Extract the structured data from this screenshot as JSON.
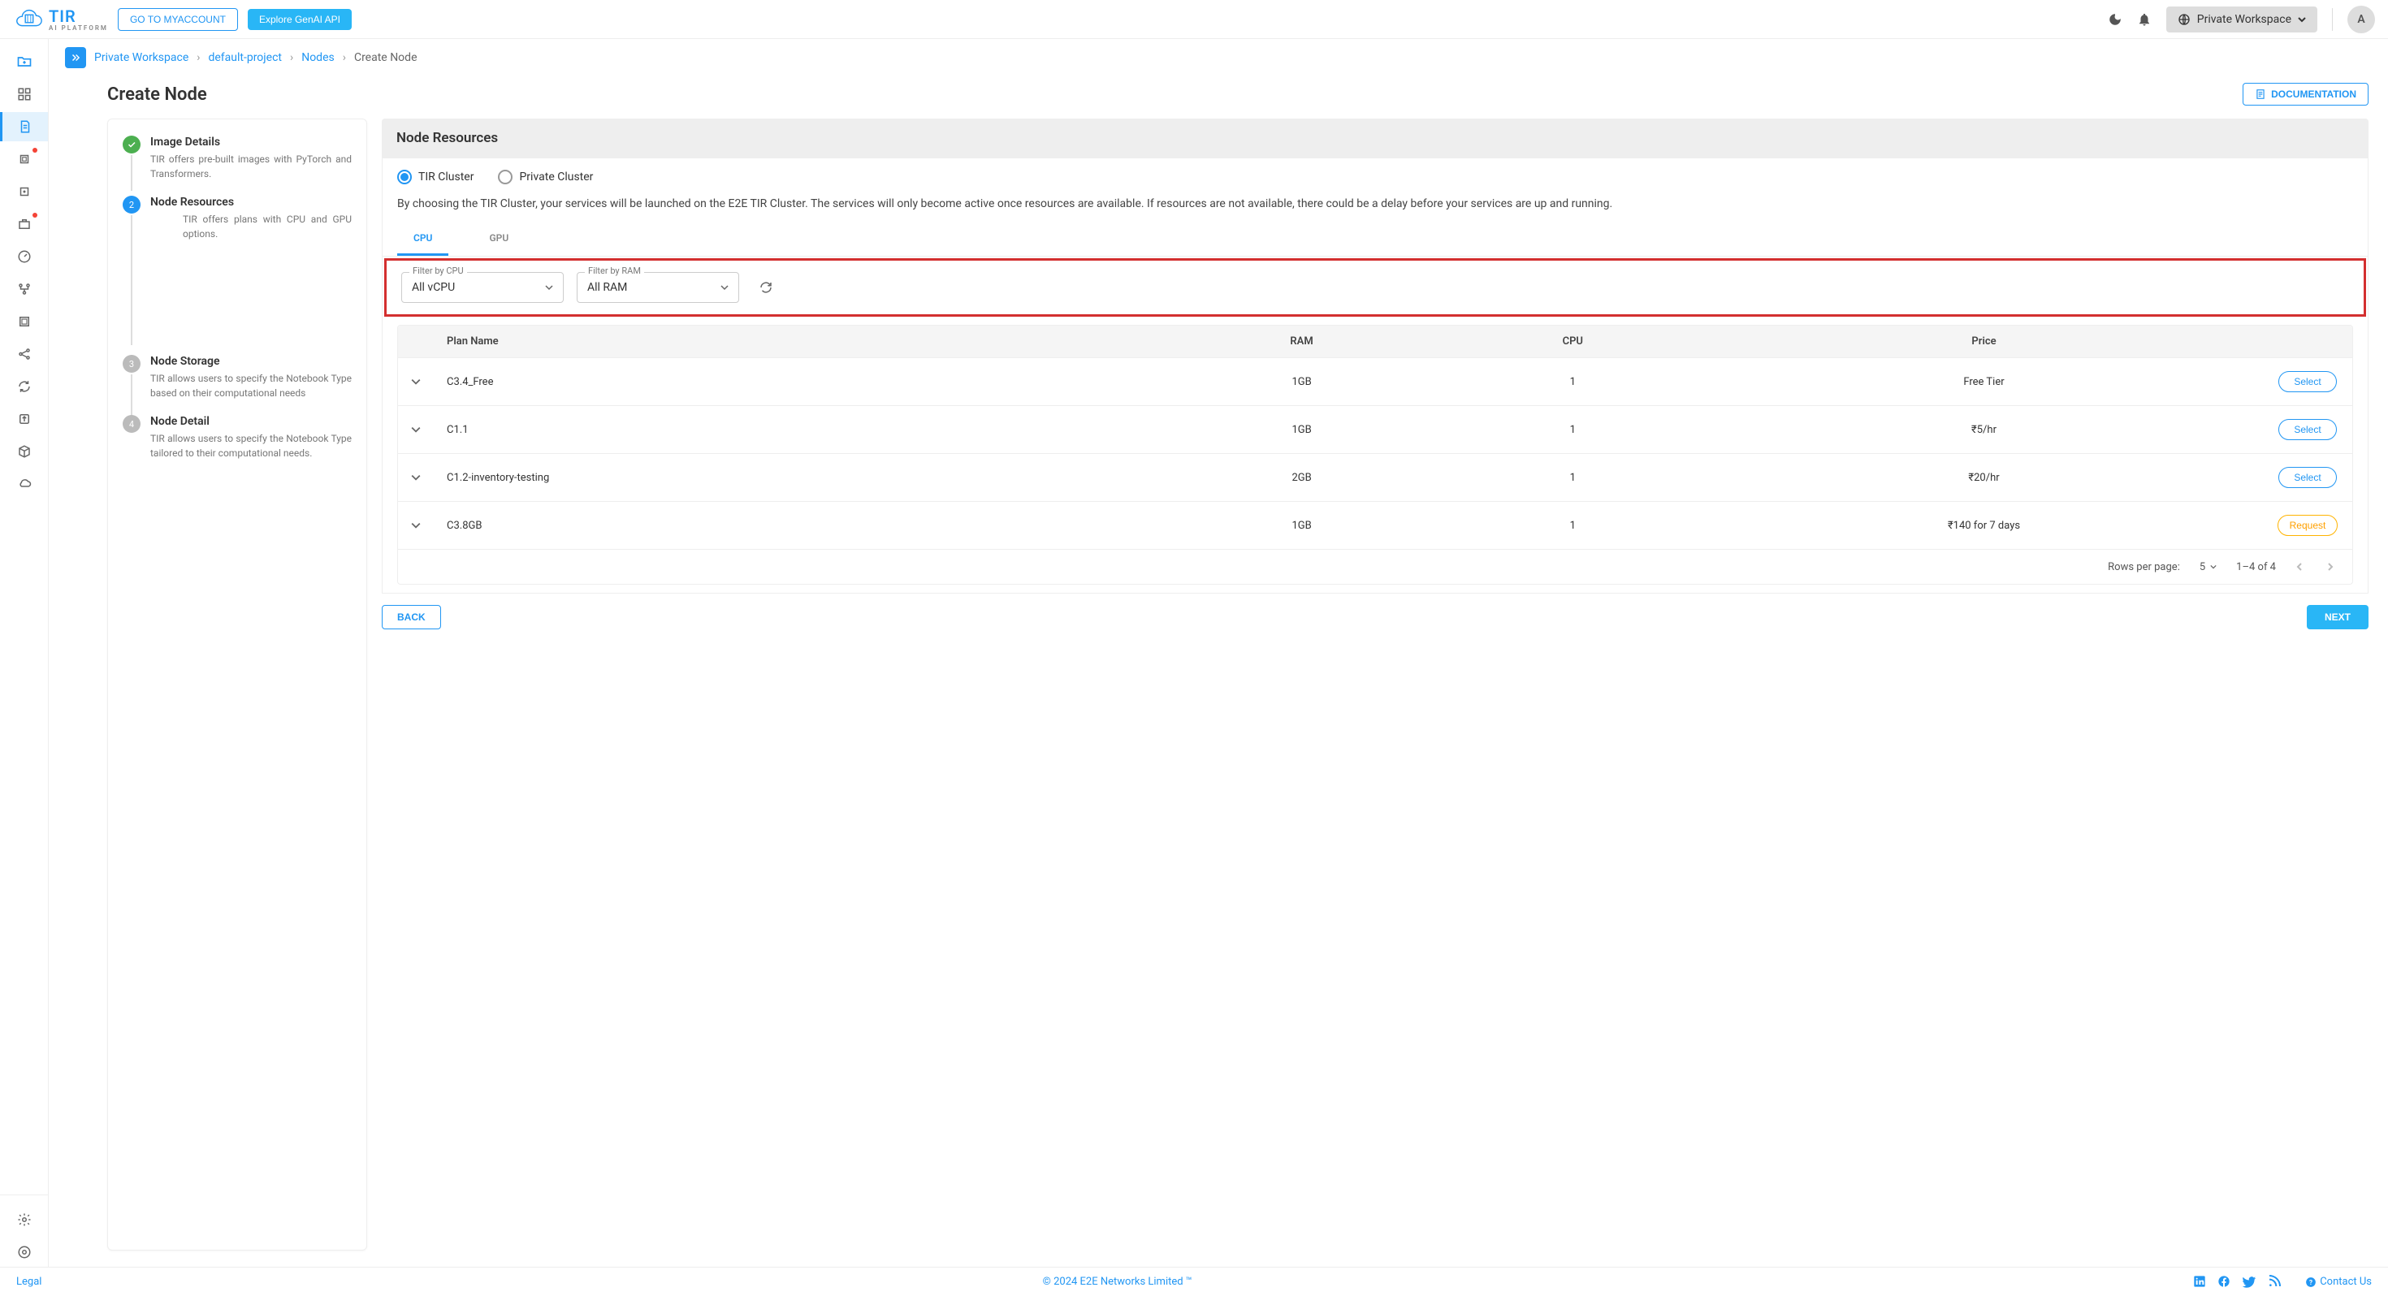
{
  "topbar": {
    "brand": "TIR",
    "brand_sub": "AI PLATFORM",
    "go_account": "GO TO MYACCOUNT",
    "explore": "Explore GenAI API",
    "workspace": "Private Workspace",
    "avatar": "A"
  },
  "breadcrumb": {
    "items": [
      "Private Workspace",
      "default-project",
      "Nodes"
    ],
    "current": "Create Node"
  },
  "page": {
    "title": "Create Node",
    "doc_btn": "DOCUMENTATION"
  },
  "steps": [
    {
      "title": "Image Details",
      "desc": "TIR offers pre-built images with PyTorch and Transformers.",
      "state": "done"
    },
    {
      "title": "Node Resources",
      "desc": "TIR offers plans with CPU and GPU options.",
      "state": "active"
    },
    {
      "title": "Node Storage",
      "desc": "TIR allows users to specify the Notebook Type based on their computational needs",
      "state": "pending",
      "num": "3"
    },
    {
      "title": "Node Detail",
      "desc": "TIR allows users to specify the Notebook Type tailored to their computational needs.",
      "state": "pending",
      "num": "4"
    }
  ],
  "resources": {
    "header": "Node Resources",
    "radios": {
      "tir": "TIR Cluster",
      "private": "Private Cluster"
    },
    "desc": "By choosing the TIR Cluster, your services will be launched on the E2E TIR Cluster. The services will only become active once resources are available. If resources are not available, there could be a delay before your services are up and running.",
    "tabs": {
      "cpu": "CPU",
      "gpu": "GPU"
    },
    "filters": {
      "cpu_label": "Filter by CPU",
      "cpu_value": "All vCPU",
      "ram_label": "Filter by RAM",
      "ram_value": "All RAM"
    },
    "table": {
      "headers": {
        "plan": "Plan Name",
        "ram": "RAM",
        "cpu": "CPU",
        "price": "Price"
      },
      "rows": [
        {
          "plan": "C3.4_Free",
          "ram": "1GB",
          "cpu": "1",
          "price": "Free Tier",
          "action": "Select"
        },
        {
          "plan": "C1.1",
          "ram": "1GB",
          "cpu": "1",
          "price": "₹5/hr",
          "action": "Select"
        },
        {
          "plan": "C1.2-inventory-testing",
          "ram": "2GB",
          "cpu": "1",
          "price": "₹20/hr",
          "action": "Select"
        },
        {
          "plan": "C3.8GB",
          "ram": "1GB",
          "cpu": "1",
          "price": "₹140 for 7 days",
          "action": "Request"
        }
      ],
      "footer": {
        "rows_label": "Rows per page:",
        "rows_value": "5",
        "range": "1–4 of 4"
      }
    },
    "nav": {
      "back": "BACK",
      "next": "NEXT"
    }
  },
  "footer": {
    "legal": "Legal",
    "copyright": "© 2024 E2E Networks Limited ™",
    "contact": "Contact Us"
  }
}
